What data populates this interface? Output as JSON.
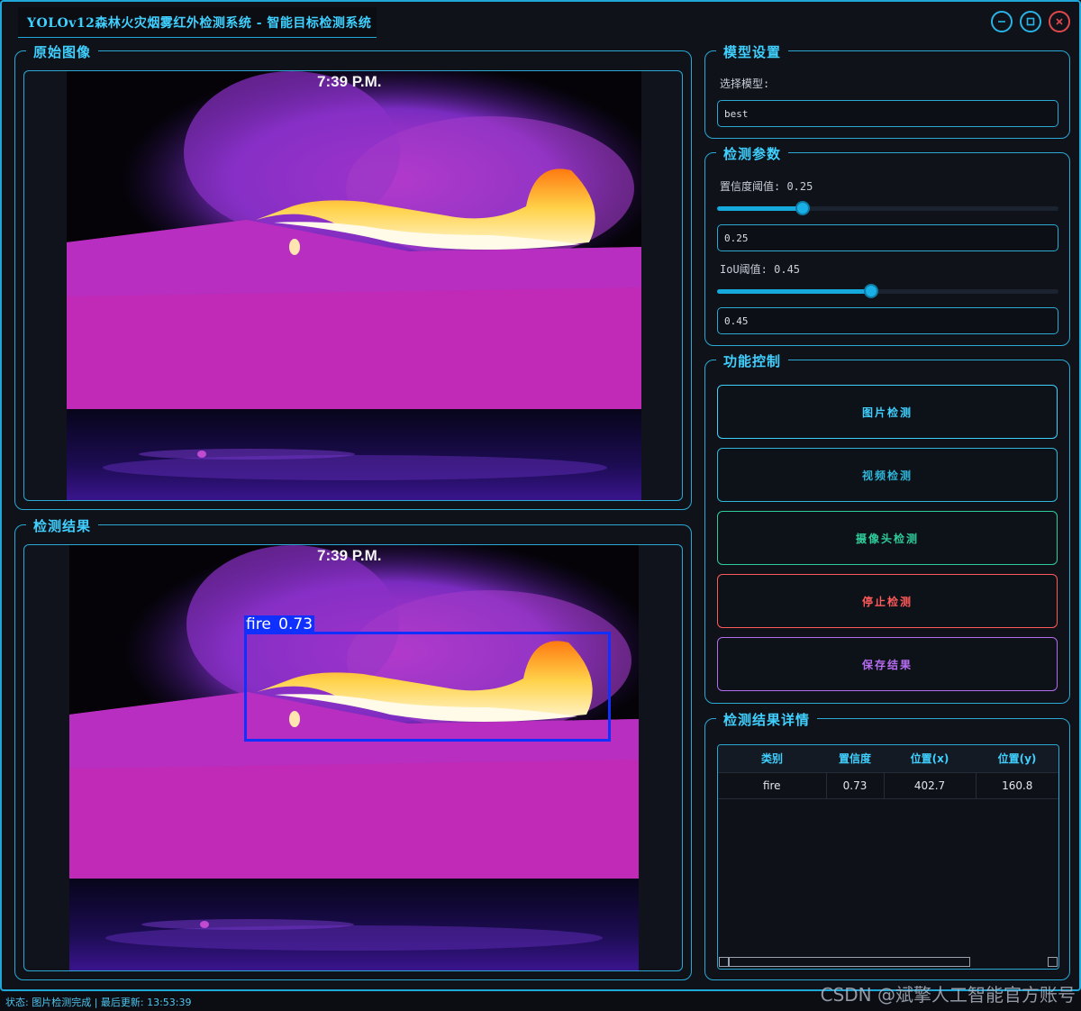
{
  "window": {
    "title": "YOLOv12森林火灾烟雾红外检测系统 - 智能目标检测系统",
    "minimize_icon": "minimize-icon",
    "maximize_icon": "maximize-icon",
    "close_icon": "close-icon"
  },
  "original_panel": {
    "title": "原始图像",
    "timestamp": "7:39 P.M."
  },
  "result_panel": {
    "title": "检测结果",
    "timestamp": "7:39 P.M.",
    "box_label": "fire 0.73"
  },
  "model_settings": {
    "title": "模型设置",
    "select_label": "选择模型:",
    "selected_model": "best"
  },
  "detect_params": {
    "title": "检测参数",
    "conf_label": "置信度阈值: 0.25",
    "conf_value": "0.25",
    "conf_fraction": 0.25,
    "iou_label": "IoU阈值: 0.45",
    "iou_value": "0.45",
    "iou_fraction": 0.45
  },
  "controls": {
    "title": "功能控制",
    "buttons": [
      {
        "label": "图片检测",
        "color": "#3fd0ff"
      },
      {
        "label": "视频检测",
        "color": "#2fb6d8"
      },
      {
        "label": "摄像头检测",
        "color": "#2ecc9a"
      },
      {
        "label": "停止检测",
        "color": "#ff5a5a"
      },
      {
        "label": "保存结果",
        "color": "#b56cf0"
      }
    ]
  },
  "results_table": {
    "title": "检测结果详情",
    "columns": [
      "类别",
      "置信度",
      "位置(x)",
      "位置(y)"
    ],
    "rows": [
      [
        "fire",
        "0.73",
        "402.7",
        "160.8"
      ]
    ]
  },
  "status": {
    "text": "状态: 图片检测完成 | 最后更新: 13:53:39"
  },
  "watermark": "CSDN @斌擎人工智能官方账号",
  "colors": {
    "accent": "#3fd0ff",
    "border": "#2aa9d6",
    "box": "#1030ff"
  }
}
